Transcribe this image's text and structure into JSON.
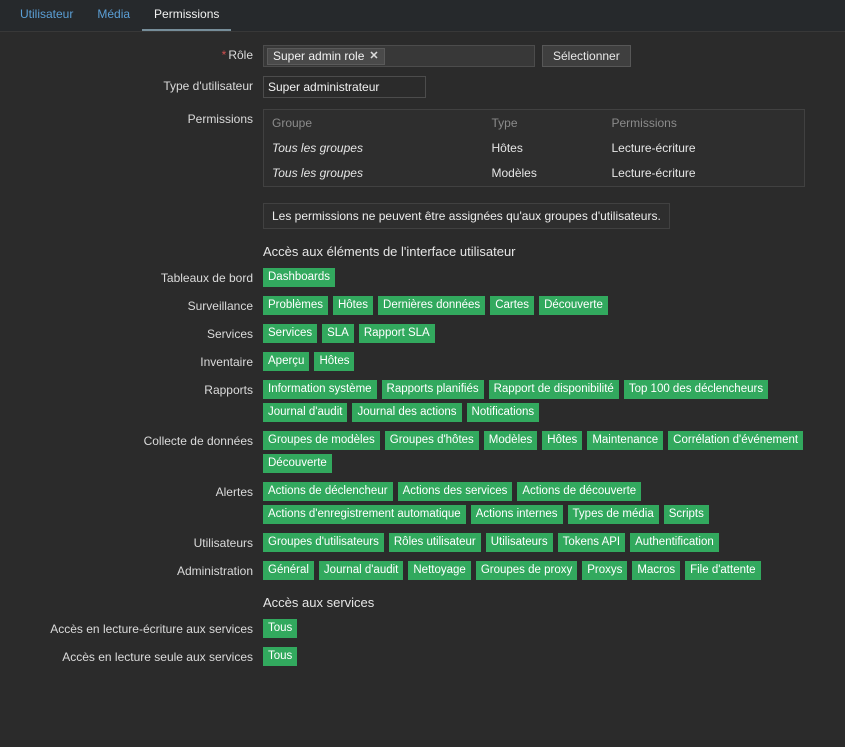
{
  "tabs": [
    {
      "label": "Utilisateur",
      "active": false
    },
    {
      "label": "Média",
      "active": false
    },
    {
      "label": "Permissions",
      "active": true
    }
  ],
  "form": {
    "role": {
      "label": "Rôle",
      "required_marker": "*",
      "chip": "Super admin role",
      "chip_remove_icon": "✕",
      "select_button": "Sélectionner"
    },
    "user_type": {
      "label": "Type d'utilisateur",
      "value": "Super administrateur"
    },
    "permissions": {
      "label": "Permissions",
      "columns": [
        "Groupe",
        "Type",
        "Permissions"
      ],
      "rows": [
        [
          "Tous les groupes",
          "Hôtes",
          "Lecture-écriture"
        ],
        [
          "Tous les groupes",
          "Modèles",
          "Lecture-écriture"
        ]
      ]
    },
    "info_message": "Les permissions ne peuvent être assignées qu'aux groupes d'utilisateurs."
  },
  "ui_access": {
    "heading": "Accès aux éléments de l'interface utilisateur",
    "groups": [
      {
        "label": "Tableaux de bord",
        "tags": [
          "Dashboards"
        ]
      },
      {
        "label": "Surveillance",
        "tags": [
          "Problèmes",
          "Hôtes",
          "Dernières données",
          "Cartes",
          "Découverte"
        ]
      },
      {
        "label": "Services",
        "tags": [
          "Services",
          "SLA",
          "Rapport SLA"
        ]
      },
      {
        "label": "Inventaire",
        "tags": [
          "Aperçu",
          "Hôtes"
        ]
      },
      {
        "label": "Rapports",
        "tags": [
          "Information système",
          "Rapports planifiés",
          "Rapport de disponibilité",
          "Top 100 des déclencheurs",
          "Journal d'audit",
          "Journal des actions",
          "Notifications"
        ]
      },
      {
        "label": "Collecte de données",
        "tags": [
          "Groupes de modèles",
          "Groupes d'hôtes",
          "Modèles",
          "Hôtes",
          "Maintenance",
          "Corrélation d'événement",
          "Découverte"
        ]
      },
      {
        "label": "Alertes",
        "tags": [
          "Actions de déclencheur",
          "Actions des services",
          "Actions de découverte",
          "Actions d'enregistrement automatique",
          "Actions internes",
          "Types de média",
          "Scripts"
        ]
      },
      {
        "label": "Utilisateurs",
        "tags": [
          "Groupes d'utilisateurs",
          "Rôles utilisateur",
          "Utilisateurs",
          "Tokens API",
          "Authentification"
        ]
      },
      {
        "label": "Administration",
        "tags": [
          "Général",
          "Journal d'audit",
          "Nettoyage",
          "Groupes de proxy",
          "Proxys",
          "Macros",
          "File d'attente"
        ]
      }
    ]
  },
  "service_access": {
    "heading": "Accès aux services",
    "groups": [
      {
        "label": "Accès en lecture-écriture aux services",
        "tags": [
          "Tous"
        ]
      },
      {
        "label": "Accès en lecture seule aux services",
        "tags": [
          "Tous"
        ]
      }
    ]
  },
  "colors": {
    "background": "#2b2b2b",
    "tag_green": "#32a95e",
    "link_blue": "#5b9fd6",
    "required_red": "#d14f4f"
  }
}
